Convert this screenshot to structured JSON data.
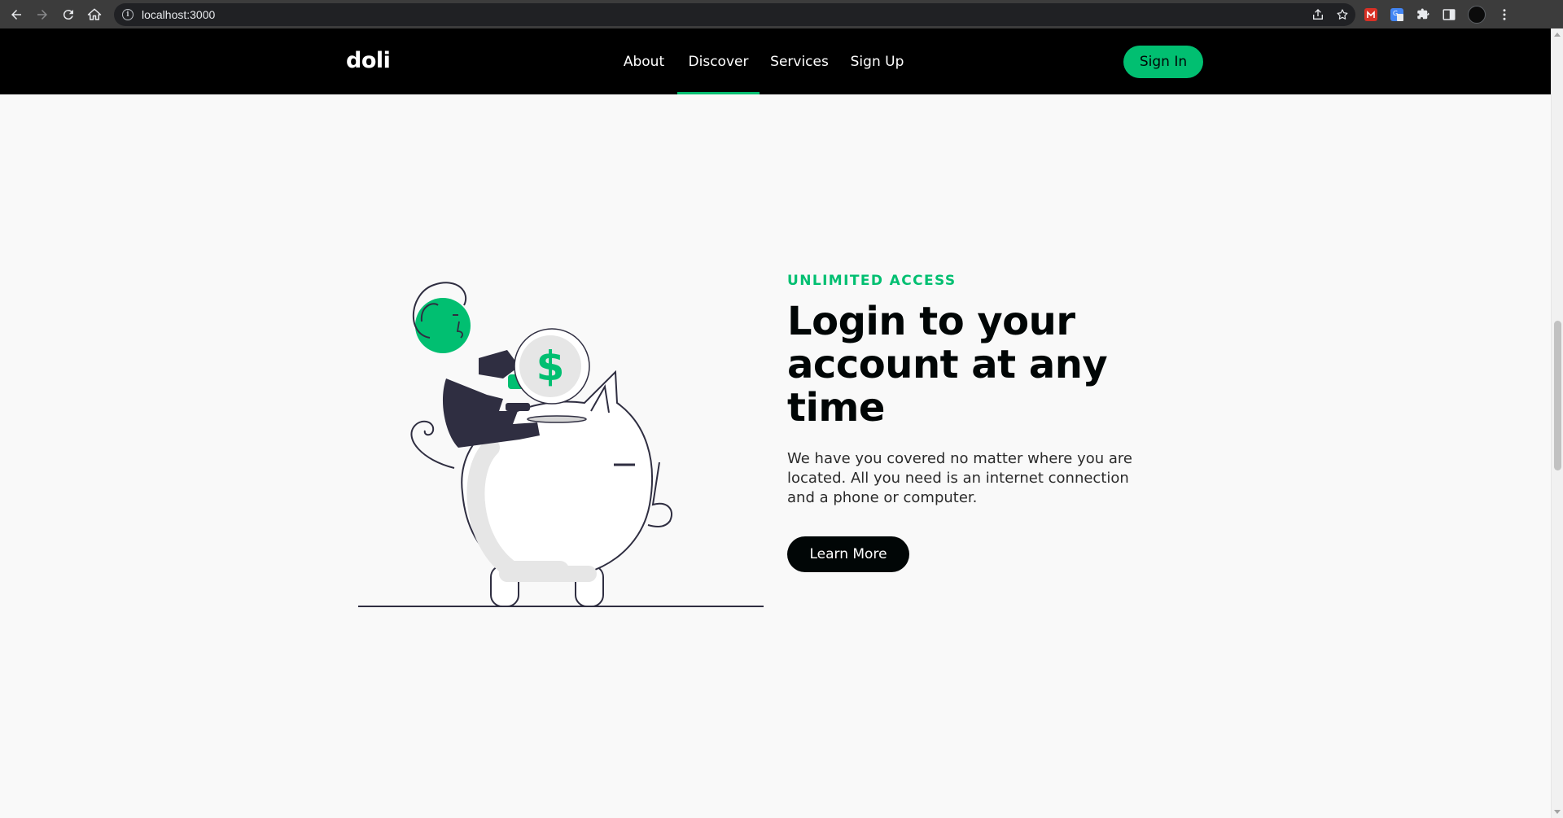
{
  "browser": {
    "url": "localhost:3000",
    "icons": [
      "back-arrow-icon",
      "forward-arrow-icon",
      "reload-icon",
      "home-icon",
      "site-info-icon",
      "share-icon",
      "bookmark-star-icon",
      "extension-icon",
      "translate-icon",
      "puzzle-icon",
      "side-panel-icon",
      "profile-avatar",
      "kebab-menu-icon"
    ]
  },
  "header": {
    "logo": "doli",
    "nav": [
      {
        "label": "About",
        "active": false
      },
      {
        "label": "Discover",
        "active": true
      },
      {
        "label": "Services",
        "active": false
      },
      {
        "label": "Sign Up",
        "active": false
      }
    ],
    "signin_label": "Sign In"
  },
  "hero": {
    "top_line": "UNLIMITED ACCESS",
    "heading": "Login to your account at any time",
    "subtitle": "We have you covered no matter where you are located. All you need is an internet connection and a phone or computer.",
    "button_label": "Learn More",
    "illustration_coin_symbol": "$"
  },
  "colors": {
    "accent": "#01bf71",
    "header_bg": "#000000",
    "page_bg": "#f9f9f9",
    "dark": "#010606",
    "illustration_dark": "#2f2e41"
  }
}
